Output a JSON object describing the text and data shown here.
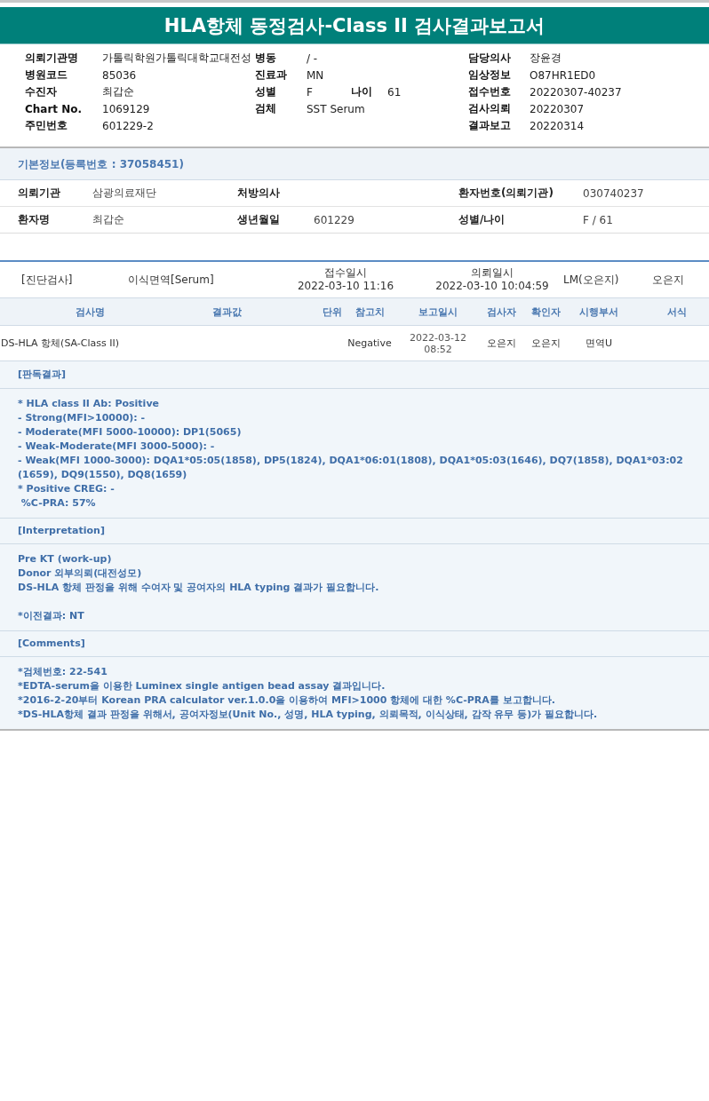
{
  "title": "HLA항체 동정검사-Class II 검사결과보고서",
  "header": [
    {
      "label": "의뢰기관명",
      "value": "가톨릭학원가톨릭대학교대전성",
      "label2": "병동",
      "value2": "/ -",
      "label3": "담당의사",
      "value3": "장윤경"
    },
    {
      "label": "병원코드",
      "value": "85036",
      "label2": "진료과",
      "value2": "MN",
      "label3": "임상정보",
      "value3": "O87HR1ED0"
    },
    {
      "label": "수진자",
      "value": "최갑순",
      "label2": "성별",
      "value2": "F",
      "label_age": "나이",
      "value_age": "61",
      "label3": "접수번호",
      "value3": "20220307-40237"
    },
    {
      "label": "Chart No.",
      "value": "1069129",
      "label2": "검체",
      "value2": "SST Serum",
      "label3": "검사의뢰",
      "value3": "20220307"
    },
    {
      "label": "주민번호",
      "value": "601229-2",
      "label3": "결과보고",
      "value3": "20220314"
    }
  ],
  "basic_info": {
    "title": "기본정보(등록번호 : 37058451)",
    "rows": [
      [
        {
          "label": "의뢰기관",
          "value": "삼광의료재단"
        },
        {
          "label": "처방의사"
        },
        {
          "label": "환자번호(의뢰기관)",
          "value": "030740237"
        }
      ],
      [
        {
          "label": "환자명",
          "value": "최갑순"
        },
        {
          "label": "생년월일",
          "value": "601229"
        },
        {
          "label": "성별/나이",
          "value": "F / 61"
        }
      ]
    ]
  },
  "order": {
    "category": "[진단검사]",
    "test_group": "이식면역[Serum]",
    "received_label": "접수일시",
    "received": "2022-03-10 11:16",
    "requested_label": "의뢰일시",
    "requested": "2022-03-10 10:04:59",
    "lab": "LM(오은지)",
    "staff": "오은지"
  },
  "table": {
    "columns": [
      "검사명",
      "결과값",
      "단위",
      "참고치",
      "보고일시",
      "검사자",
      "확인자",
      "시행부서",
      "서식"
    ],
    "rows": [
      {
        "name": "DS-HLA 항체(SA-Class II)",
        "reference": "Negative",
        "report_date": "2022-03-12",
        "report_time": "08:52",
        "tester": "오은지",
        "confirmer": "오은지",
        "department": "면역U"
      }
    ]
  },
  "sections": [
    {
      "title": "[판독결과]",
      "paragraphs": [
        [
          "* HLA class II Ab: Positive",
          "- Strong(MFI>10000): -",
          "- Moderate(MFI 5000-10000): DP1(5065)",
          "- Weak-Moderate(MFI 3000-5000): -",
          "- Weak(MFI 1000-3000): DQA1*05:05(1858), DP5(1824), DQA1*06:01(1808), DQA1*05:03(1646), DQ7(1858), DQA1*03:02(1659), DQ9(1550), DQ8(1659)",
          "* Positive CREG: -",
          " %C-PRA: 57%"
        ]
      ]
    },
    {
      "title": "[Interpretation]",
      "paragraphs": [
        [
          "Pre KT (work-up)",
          "Donor 외부의뢰(대전성모)",
          "DS-HLA 항체 판정을 위해 수여자 및 공여자의 HLA typing 결과가 필요합니다."
        ],
        [
          "*이전결과: NT"
        ]
      ]
    },
    {
      "title": "[Comments]",
      "paragraphs": [
        [
          "*검체번호: 22-541",
          "*EDTA-serum을 이용한 Luminex single antigen bead assay 결과입니다.",
          "*2016-2-20부터 Korean PRA calculator ver.1.0.0을 이용하여 MFI>1000 항체에 대한 %C-PRA를 보고합니다.",
          "*DS-HLA항체 결과 판정을 위해서, 공여자정보(Unit No., 성명, HLA typing, 의뢰목적, 이식상태, 감작 유무 등)가 필요합니다."
        ]
      ]
    }
  ]
}
